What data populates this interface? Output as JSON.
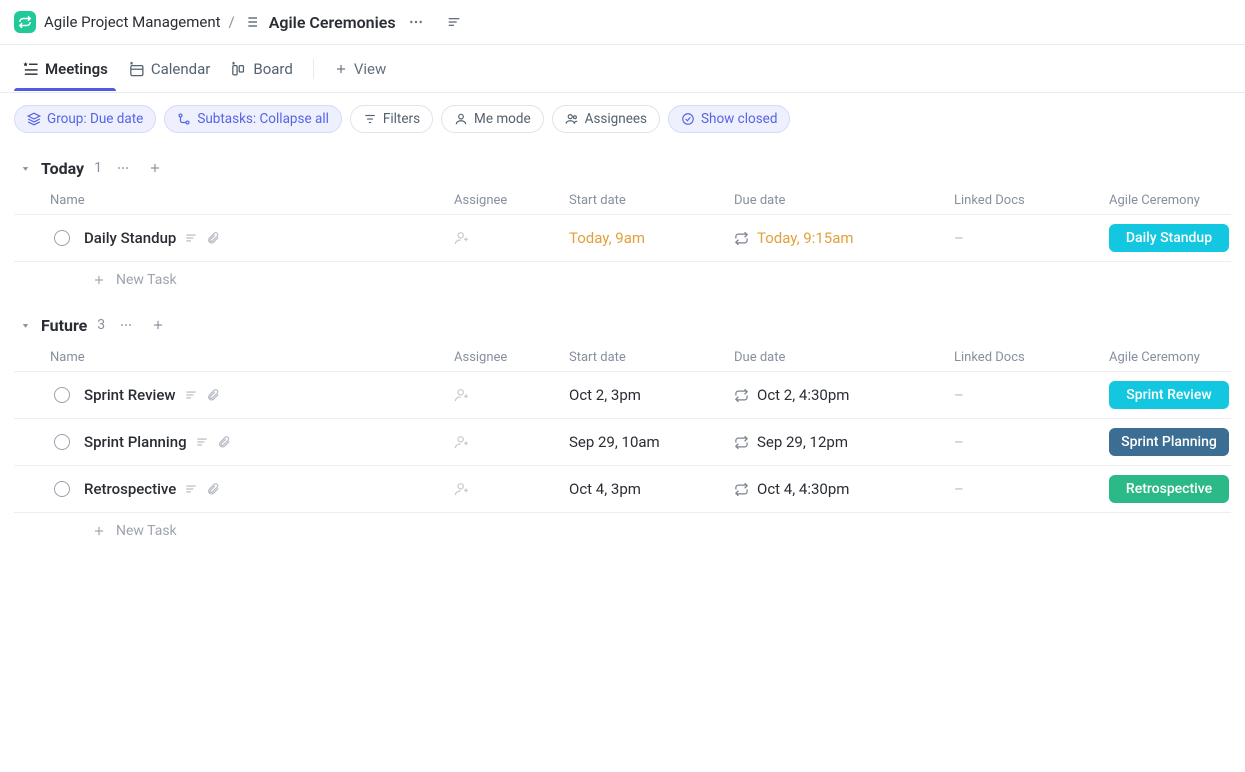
{
  "breadcrumb": {
    "project": "Agile Project Management",
    "separator": "/",
    "page": "Agile Ceremonies"
  },
  "tabs": [
    {
      "label": "Meetings",
      "icon": "list-meeting",
      "active": true
    },
    {
      "label": "Calendar",
      "icon": "calendar",
      "active": false
    },
    {
      "label": "Board",
      "icon": "board",
      "active": false
    }
  ],
  "addView": "View",
  "filters": [
    {
      "label": "Group: Due date",
      "icon": "layers",
      "primary": true
    },
    {
      "label": "Subtasks: Collapse all",
      "icon": "subtask",
      "primary": true
    },
    {
      "label": "Filters",
      "icon": "filter",
      "primary": false
    },
    {
      "label": "Me mode",
      "icon": "person",
      "primary": false
    },
    {
      "label": "Assignees",
      "icon": "people",
      "primary": false
    },
    {
      "label": "Show closed",
      "icon": "check-circle",
      "primary": true
    }
  ],
  "columns": [
    "Name",
    "Assignee",
    "Start date",
    "Due date",
    "Linked Docs",
    "Agile Ceremony"
  ],
  "groups": [
    {
      "title": "Today",
      "count": "1",
      "tasks": [
        {
          "name": "Daily Standup",
          "start": "Today, 9am",
          "due": "Today, 9:15am",
          "amber": true,
          "recurring": true,
          "linked": "–",
          "ceremony": "Daily Standup",
          "ceremonyColor": "cyan"
        }
      ]
    },
    {
      "title": "Future",
      "count": "3",
      "tasks": [
        {
          "name": "Sprint Review",
          "start": "Oct 2, 3pm",
          "due": "Oct 2, 4:30pm",
          "amber": false,
          "recurring": true,
          "linked": "–",
          "ceremony": "Sprint Review",
          "ceremonyColor": "cyan"
        },
        {
          "name": "Sprint Planning",
          "start": "Sep 29, 10am",
          "due": "Sep 29, 12pm",
          "amber": false,
          "recurring": true,
          "linked": "–",
          "ceremony": "Sprint Planning",
          "ceremonyColor": "navy"
        },
        {
          "name": "Retrospective",
          "start": "Oct 4, 3pm",
          "due": "Oct 4, 4:30pm",
          "amber": false,
          "recurring": true,
          "linked": "–",
          "ceremony": "Retrospective",
          "ceremonyColor": "green"
        }
      ]
    }
  ],
  "newTask": "New Task"
}
